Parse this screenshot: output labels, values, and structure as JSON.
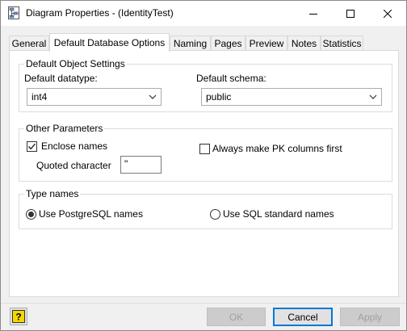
{
  "window": {
    "title": "Diagram Properties - (IdentityTest)"
  },
  "tabs": [
    {
      "label": "General",
      "active": false
    },
    {
      "label": "Default Database Options",
      "active": true
    },
    {
      "label": "Naming",
      "active": false
    },
    {
      "label": "Pages",
      "active": false
    },
    {
      "label": "Preview",
      "active": false
    },
    {
      "label": "Notes",
      "active": false
    },
    {
      "label": "Statistics",
      "active": false
    }
  ],
  "default_object_settings": {
    "group_title": "Default Object Settings",
    "datatype_label": "Default datatype:",
    "datatype_value": "int4",
    "schema_label": "Default schema:",
    "schema_value": "public"
  },
  "other_parameters": {
    "group_title": "Other Parameters",
    "enclose_names_label": "Enclose names",
    "enclose_names_checked": true,
    "quoted_character_label": "Quoted character",
    "quoted_character_value": "\"",
    "pk_first_label": "Always make PK columns first",
    "pk_first_checked": false
  },
  "type_names": {
    "group_title": "Type names",
    "postgres_label": "Use PostgreSQL names",
    "sql_standard_label": "Use SQL standard names",
    "selected": "postgres"
  },
  "buttons": {
    "ok_label": "OK",
    "cancel_label": "Cancel",
    "apply_label": "Apply",
    "help_label": "?"
  },
  "icons": {
    "app": "diagram-properties-icon",
    "minimize": "minimize-icon",
    "maximize": "maximize-icon",
    "close": "close-icon",
    "dropdown": "chevron-down-icon",
    "check": "checkmark-icon",
    "help": "help-icon"
  },
  "colors": {
    "accent_border": "#0078d7",
    "help_icon_fill": "#f5d700"
  }
}
